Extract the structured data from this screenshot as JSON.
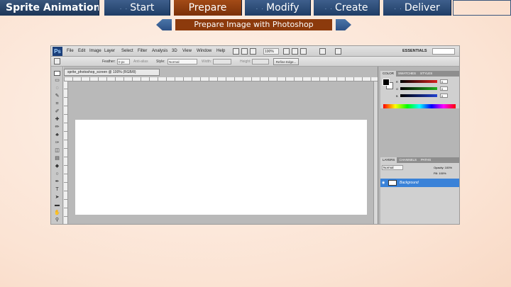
{
  "nav": {
    "title": "Sprite Animation",
    "tabs": [
      {
        "label": "Start",
        "active": false
      },
      {
        "label": "Prepare",
        "active": true
      },
      {
        "label": "Modify",
        "active": false
      },
      {
        "label": "Create",
        "active": false
      },
      {
        "label": "Deliver",
        "active": false
      }
    ]
  },
  "sub": {
    "title": "Prepare Image with Photoshop"
  },
  "photoshop": {
    "logo": "Ps",
    "menu": [
      "File",
      "Edit",
      "Image",
      "Layer",
      "Select",
      "Filter",
      "Analysis",
      "3D",
      "View",
      "Window",
      "Help"
    ],
    "zoom": "100%",
    "workspace": "ESSENTIALS",
    "options": {
      "feather_label": "Feather:",
      "feather_value": "0 px",
      "antialias_label": "Anti-alias",
      "style_label": "Style:",
      "style_value": "Normal",
      "width_label": "Width:",
      "height_label": "Height:",
      "refine_button": "Refine Edge..."
    },
    "document_tab": "sprite_photoshop_screen @ 100% (RGB/8)",
    "color_panel": {
      "tabs": [
        "COLOR",
        "SWATCHES",
        "STYLES"
      ],
      "r_label": "R",
      "g_label": "G",
      "b_label": "B",
      "r": "0",
      "g": "0",
      "b": "0",
      "colors": {
        "r": "#d92020",
        "g": "#20b020",
        "b": "#2040d0"
      }
    },
    "layers_panel": {
      "tabs": [
        "LAYERS",
        "CHANNELS",
        "PATHS"
      ],
      "blend": "Normal",
      "opacity_label": "Opacity:",
      "opacity": "100%",
      "fill_label": "Fill:",
      "fill": "100%",
      "layer_name": "Background"
    }
  }
}
